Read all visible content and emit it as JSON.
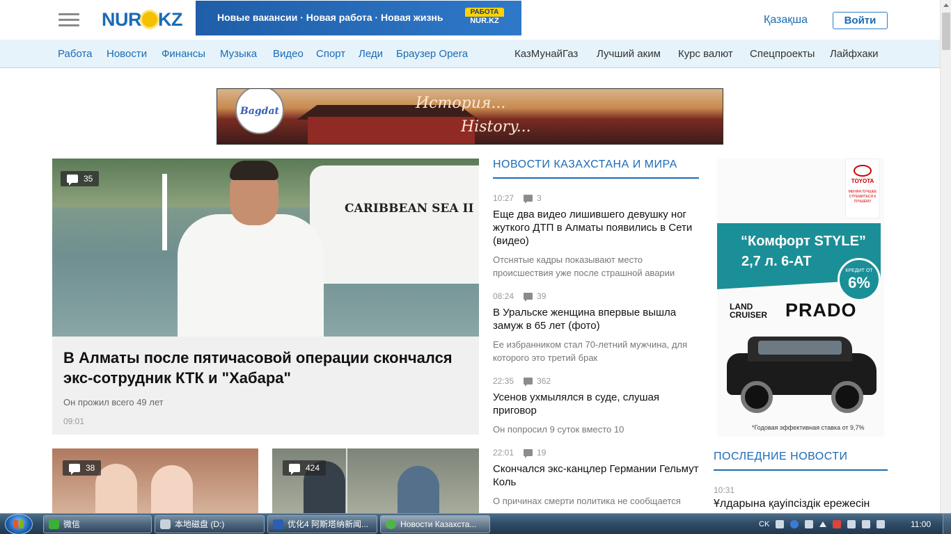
{
  "header": {
    "logo": "NUR.KZ",
    "logo_left": "NUR",
    "logo_right": "KZ",
    "banner_text": "Новые вакансии · Новая работа · Новая жизнь",
    "banner_badge_top": "РАБОТА",
    "banner_badge_bottom": "NUR.KZ",
    "lang_link": "Қазақша",
    "login_button": "Войти"
  },
  "nav": {
    "items": [
      "Работа",
      "Новости",
      "Финансы",
      "Музыка",
      "Видео",
      "Спорт",
      "Леди",
      "Браузер Opera",
      "КазМунайГаз",
      "Лучший аким",
      "Курс валют",
      "Спецпроекты",
      "Лайфхаки"
    ]
  },
  "ad_banner": {
    "brand": "Bagdat",
    "script_ru": "История...",
    "script_en": "History..."
  },
  "main_article": {
    "comments": "35",
    "boat_name": "CARIBBEAN SEA II",
    "title": "В Алматы после пятичасовой операции скончался экс-сотрудник КТК и \"Хабара\"",
    "lead": "Он прожил всего 49 лет",
    "time": "09:01"
  },
  "cards": [
    {
      "comments": "38"
    },
    {
      "comments": "424"
    }
  ],
  "news_section": {
    "title": "НОВОСТИ КАЗАХСТАНА И МИРА",
    "items": [
      {
        "time": "10:27",
        "comments": "3",
        "title": "Еще два видео лишившего девушку ног жуткого ДТП в Алматы появились в Сети (видео)",
        "lead": "Отснятые кадры показывают место происшествия уже после страшной аварии"
      },
      {
        "time": "08:24",
        "comments": "39",
        "title": "В Уральске женщина впервые вышла замуж в 65 лет (фото)",
        "lead": "Ее избранником стал 70-летний мужчина, для которого это третий брак"
      },
      {
        "time": "22:35",
        "comments": "362",
        "title": "Усенов ухмылялся в суде, слушая приговор",
        "lead": "Он попросил 9 суток вместо 10"
      },
      {
        "time": "22:01",
        "comments": "19",
        "title": "Скончался экс-канцлер Германии Гельмут Коль",
        "lead": "О причинах смерти политика не сообщается"
      }
    ]
  },
  "side_ad": {
    "brand": "TOYOTA",
    "brand_sub": "МЕНЯЯ ЛУЧШЕЕ СТРЕМИТЬСЯ К ЛУЧШЕМУ",
    "line1": "“Комфорт STYLE”",
    "line2": "2,7 л. 6-АТ",
    "rate_label": "КРЕДИТ ОТ",
    "rate_value": "6%",
    "model_small": "LAND CRUISER",
    "model_big": "PRADO",
    "note": "*Годовая эффективная ставка от 9,7%"
  },
  "latest_section": {
    "title": "ПОСЛЕДНИЕ НОВОСТИ",
    "first_time": "10:31",
    "first_title": "Ұлдарына қауіпсіздік ережесін"
  },
  "taskbar": {
    "tasks": [
      "微信",
      "本地磁盘 (D:)",
      "优化4 阿斯塔纳新闻...",
      "Новости Казахста..."
    ],
    "lang": "CK",
    "clock": "11:00"
  },
  "colors": {
    "brand_blue": "#1a6bb5",
    "nav_bg": "#e6f3fa",
    "toyota_teal": "#1b8f97",
    "badge_dark": "rgba(40,40,40,0.75)"
  }
}
